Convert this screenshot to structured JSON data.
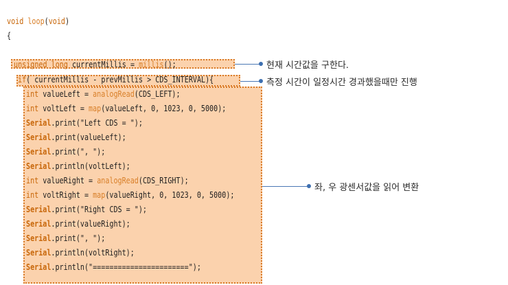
{
  "code": {
    "line_1": "void loop(void)",
    "line_2": "{",
    "line_3": "unsigned long currentMillis = millis();",
    "line_4": "if( currentMillis - prevMillis > CDS_INTERVAL){",
    "line_5": "int valueLeft = analogRead(CDS_LEFT);",
    "line_6": "int voltLeft = map(valueLeft, 0, 1023, 0, 5000);",
    "line_7": "Serial.print(\"Left CDS = \");",
    "line_8": "Serial.print(valueLeft);",
    "line_9": "Serial.print(\", \");",
    "line_10": "Serial.println(voltLeft);",
    "line_11": "int valueRight = analogRead(CDS_RIGHT);",
    "line_12": "int voltRight = map(valueRight, 0, 1023, 0, 5000);",
    "line_13": "Serial.print(\"Right CDS = \");",
    "line_14": "Serial.print(valueRight);",
    "line_15": "Serial.print(\", \");",
    "line_16": "Serial.println(voltRight);",
    "line_17": "Serial.println(\"=======================\");"
  },
  "annotations": {
    "current_time": "현재 시간값을 구한다.",
    "interval_check": "측정 시간이 일정시간 경과했을때만 진행",
    "read_sensors": "좌, 우 광센서값을 읽어 변환"
  },
  "colors": {
    "highlight_fill": "#fbd2ad",
    "highlight_border": "#d97a26",
    "keyword": "#c8670a",
    "callout_line": "#4a78b4"
  }
}
